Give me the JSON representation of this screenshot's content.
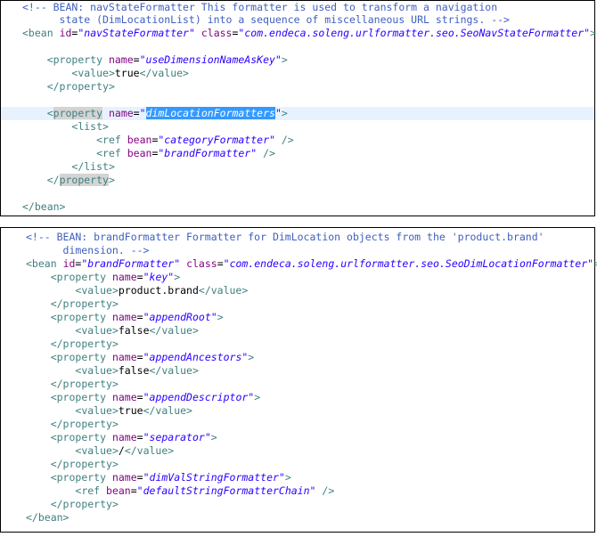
{
  "panel1": {
    "lines": [
      "<!-- BEAN: navStateFormatter This formatter is used to transform a navigation",
      "      state (DimLocationList) into a sequence of miscellaneous URL strings. -->",
      "<bean id=\"navStateFormatter\" class=\"com.endeca.soleng.urlformatter.seo.SeoNavStateFormatter\">",
      "",
      "    <property name=\"useDimensionNameAsKey\">",
      "        <value>true</value>",
      "    </property>",
      "",
      "    <property name=\"dimLocationFormatters\">",
      "        <list>",
      "            <ref bean=\"categoryFormatter\" />",
      "            <ref bean=\"brandFormatter\" />",
      "        </list>",
      "    </property>",
      "",
      "</bean>"
    ]
  },
  "panel2": {
    "lines": [
      "<!-- BEAN: brandFormatter Formatter for DimLocation objects from the 'product.brand'",
      "      dimension. -->",
      "<bean id=\"brandFormatter\" class=\"com.endeca.soleng.urlformatter.seo.SeoDimLocationFormatter\">",
      "    <property name=\"key\">",
      "        <value>product.brand</value>",
      "    </property>",
      "    <property name=\"appendRoot\">",
      "        <value>false</value>",
      "    </property>",
      "    <property name=\"appendAncestors\">",
      "        <value>false</value>",
      "    </property>",
      "    <property name=\"appendDescriptor\">",
      "        <value>true</value>",
      "    </property>",
      "    <property name=\"separator\">",
      "        <value>/</value>",
      "    </property>",
      "    <property name=\"dimValStringFormatter\">",
      "        <ref bean=\"defaultStringFormatterChain\" />",
      "    </property>",
      "</bean>"
    ]
  },
  "colors": {
    "tag": "#3f7f7f",
    "attribute": "#7f007f",
    "attribute_value": "#2a00ff",
    "comment": "#3f5fbf",
    "selection": "#3399ff",
    "current_line": "#e8f2fe"
  }
}
